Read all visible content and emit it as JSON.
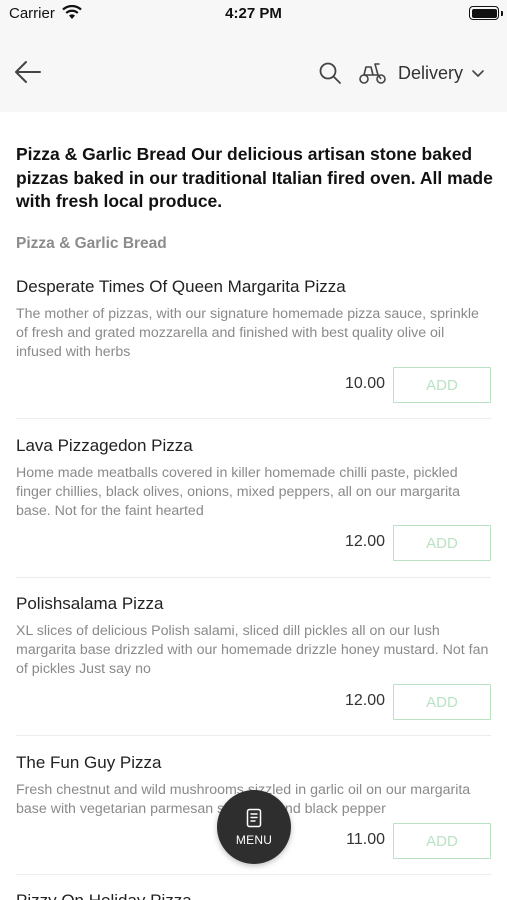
{
  "status_bar": {
    "carrier": "Carrier",
    "time": "4:27 PM"
  },
  "nav": {
    "delivery_label": "Delivery",
    "icons": [
      "back-arrow-icon",
      "search-icon",
      "scooter-icon",
      "chevron-down-icon"
    ]
  },
  "category": {
    "heading": "Pizza & Garlic Bread Our delicious artisan stone baked pizzas baked in our traditional Italian fired oven.  All made with fresh local produce.",
    "subtitle": "Pizza & Garlic Bread"
  },
  "items": [
    {
      "name": "Desperate Times Of Queen Margarita Pizza",
      "description": "The mother of pizzas, with our signature homemade pizza sauce, sprinkle of fresh and grated mozzarella and finished with best quality olive oil infused with herbs",
      "price": "10.00",
      "add_label": "ADD"
    },
    {
      "name": "Lava Pizzagedon Pizza",
      "description": "Home made meatballs covered in killer homemade chilli paste, pickled finger chillies, black olives, onions, mixed peppers, all on our margarita base.  Not for the faint hearted",
      "price": "12.00",
      "add_label": "ADD"
    },
    {
      "name": "Polishsalama Pizza",
      "description": "XL slices of delicious Polish salami, sliced dill pickles all on our lush margarita base drizzled with our homemade drizzle honey mustard. Not fan of pickles Just say no",
      "price": "12.00",
      "add_label": "ADD"
    },
    {
      "name": "The Fun Guy Pizza",
      "description": "Fresh chestnut and wild mushrooms sizzled in garlic oil on our margarita base with vegetarian parmesan shavings and black pepper",
      "price": "11.00",
      "add_label": "ADD"
    },
    {
      "name": "Pizzy On Holiday Pizza"
    }
  ],
  "fab": {
    "label": "MENU"
  },
  "colors": {
    "add_button": "#b9e2c3",
    "nav_background": "#f7f7f7",
    "fab_background": "#2e2e2e"
  }
}
